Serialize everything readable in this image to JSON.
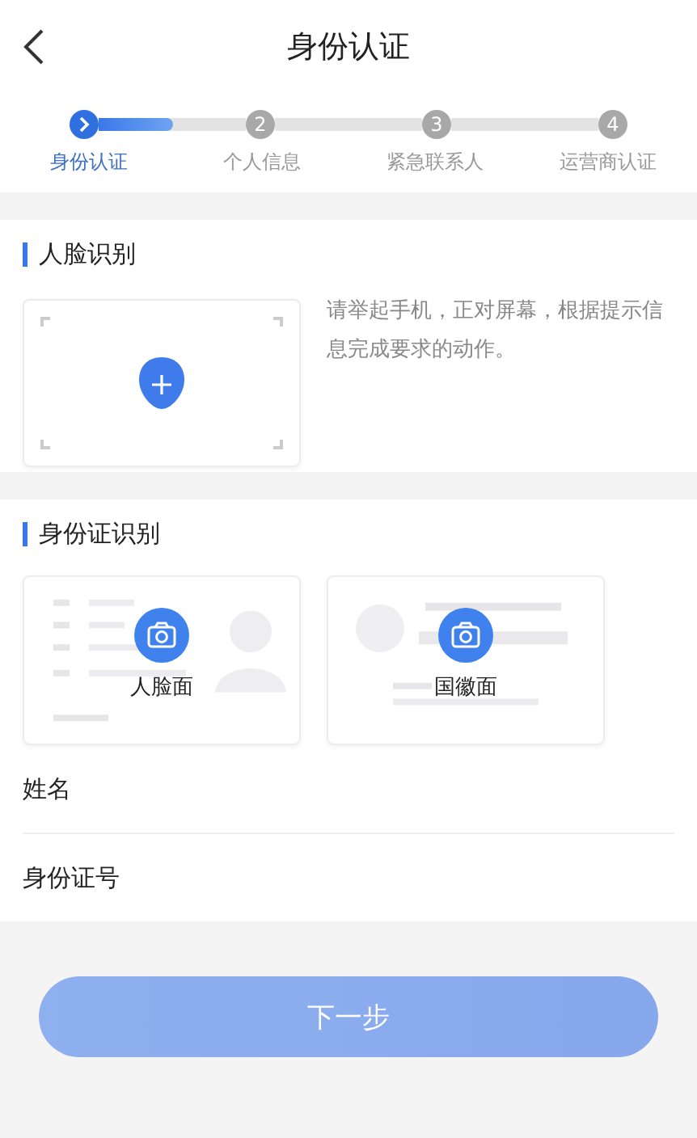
{
  "header": {
    "title": "身份认证"
  },
  "steps": {
    "level": 0.5,
    "items": [
      {
        "label": "身份认证",
        "selected": true
      },
      {
        "number": "2",
        "label": "个人信息",
        "selected": false
      },
      {
        "number": "3",
        "label": "紧急联系人",
        "selected": false
      },
      {
        "number": "4",
        "label": "运营商认证",
        "selected": false
      }
    ]
  },
  "face": {
    "heading": "人脸识别",
    "hint": "请举起手机，正对屏幕，根据提示信息完成要求的动作。"
  },
  "id_card": {
    "heading": "身份证识别",
    "sides": [
      {
        "kind": "portrait",
        "label": "人脸面"
      },
      {
        "kind": "emblem",
        "label": "国徽面"
      }
    ]
  },
  "fields": [
    {
      "label": "姓名"
    },
    {
      "label": "身份证号"
    }
  ],
  "next_button": {
    "label": "下一步",
    "disabled": true
  }
}
